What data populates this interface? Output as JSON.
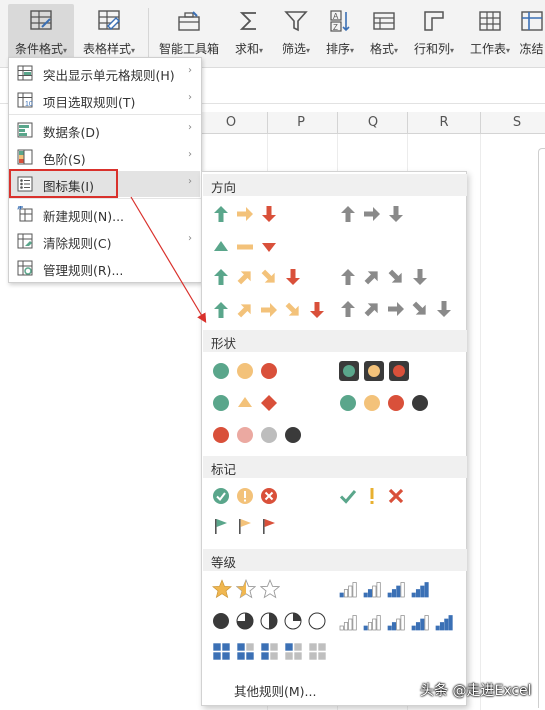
{
  "ribbon": {
    "buttons": [
      {
        "label": "条件格式",
        "caret": "▾",
        "icon": "conditional-format-icon"
      },
      {
        "label": "表格样式",
        "caret": "▾",
        "icon": "table-style-icon"
      },
      {
        "label": "智能工具箱",
        "caret": "",
        "icon": "toolbox-icon"
      },
      {
        "label": "求和",
        "caret": "▾",
        "icon": "sum-icon"
      },
      {
        "label": "筛选",
        "caret": "▾",
        "icon": "filter-icon"
      },
      {
        "label": "排序",
        "caret": "▾",
        "icon": "sort-icon"
      },
      {
        "label": "格式",
        "caret": "▾",
        "icon": "format-icon"
      },
      {
        "label": "行和列",
        "caret": "▾",
        "icon": "rows-columns-icon"
      },
      {
        "label": "工作表",
        "caret": "▾",
        "icon": "worksheet-icon"
      },
      {
        "label": "冻结",
        "caret": "",
        "icon": "freeze-icon"
      }
    ]
  },
  "sheet": {
    "columns": [
      "O",
      "P",
      "Q",
      "R",
      "S"
    ]
  },
  "menu": {
    "items": [
      {
        "label": "突出显示单元格规则(H)",
        "submenu": true,
        "icon": "highlight-rules-icon"
      },
      {
        "label": "项目选取规则(T)",
        "submenu": true,
        "icon": "top-bottom-rules-icon"
      },
      {
        "label": "数据条(D)",
        "submenu": true,
        "icon": "data-bars-icon"
      },
      {
        "label": "色阶(S)",
        "submenu": true,
        "icon": "color-scales-icon"
      },
      {
        "label": "图标集(I)",
        "submenu": true,
        "icon": "icon-sets-icon",
        "active": true
      },
      {
        "label": "新建规则(N)...",
        "submenu": false,
        "icon": "new-rule-icon"
      },
      {
        "label": "清除规则(C)",
        "submenu": true,
        "icon": "clear-rules-icon"
      },
      {
        "label": "管理规则(R)...",
        "submenu": false,
        "icon": "manage-rules-icon"
      }
    ]
  },
  "submenu": {
    "sections": [
      {
        "title": "方向"
      },
      {
        "title": "形状"
      },
      {
        "title": "标记"
      },
      {
        "title": "等级"
      }
    ],
    "more_label": "其他规则(M)...",
    "icon_sets": [
      {
        "name": "3-arrows-colored",
        "icons": [
          "arrow-up-green-icon",
          "arrow-right-yellow-icon",
          "arrow-down-red-icon"
        ]
      },
      {
        "name": "3-arrows-gray",
        "icons": [
          "arrow-up-gray-icon",
          "arrow-right-gray-icon",
          "arrow-down-gray-icon"
        ]
      },
      {
        "name": "3-triangles",
        "icons": [
          "triangle-up-green-icon",
          "dash-yellow-icon",
          "triangle-down-red-icon"
        ]
      },
      {
        "name": "4-arrows-gray",
        "icons": [
          "arrow-up-gray-icon",
          "arrow-upright-gray-icon",
          "arrow-downright-gray-icon",
          "arrow-down-gray-icon"
        ]
      },
      {
        "name": "4-arrows-colored",
        "icons": [
          "arrow-up-green-icon",
          "arrow-upright-yellow-icon",
          "arrow-downright-yellow-icon",
          "arrow-down-red-icon"
        ]
      },
      {
        "name": "5-arrows-gray",
        "icons": [
          "arrow-up-gray-icon",
          "arrow-upright-gray-icon",
          "arrow-right-gray-icon",
          "arrow-downright-gray-icon",
          "arrow-down-gray-icon"
        ]
      },
      {
        "name": "5-arrows-colored",
        "icons": [
          "arrow-up-green-icon",
          "arrow-upright-yellow-icon",
          "arrow-right-yellow-icon",
          "arrow-downright-yellow-icon",
          "arrow-down-red-icon"
        ]
      },
      {
        "name": "3-traffic-lights-unrimmed",
        "icons": [
          "circle-green-icon",
          "circle-yellow-icon",
          "circle-red-icon"
        ]
      },
      {
        "name": "3-traffic-lights-rimmed",
        "icons": [
          "traffic-light-green-icon",
          "traffic-light-yellow-icon",
          "traffic-light-red-icon"
        ]
      },
      {
        "name": "3-signs",
        "icons": [
          "circle-green-icon",
          "triangle-yellow-icon",
          "diamond-red-icon"
        ]
      },
      {
        "name": "4-traffic-lights",
        "icons": [
          "circle-green-icon",
          "circle-yellow-icon",
          "circle-red-icon",
          "circle-black-icon"
        ]
      },
      {
        "name": "4-red-to-black",
        "icons": [
          "circle-red-icon",
          "circle-pink-icon",
          "circle-gray-icon",
          "circle-black-icon"
        ]
      },
      {
        "name": "3-symbols-circled",
        "icons": [
          "check-circle-green-icon",
          "exclamation-circle-yellow-icon",
          "x-circle-red-icon"
        ]
      },
      {
        "name": "3-symbols-uncircled",
        "icons": [
          "check-green-icon",
          "exclamation-yellow-icon",
          "x-red-icon"
        ]
      },
      {
        "name": "3-flags",
        "icons": [
          "flag-green-icon",
          "flag-yellow-icon",
          "flag-red-icon"
        ]
      },
      {
        "name": "3-stars",
        "icons": [
          "star-full-icon",
          "star-half-icon",
          "star-empty-icon"
        ]
      },
      {
        "name": "4-ratings",
        "icons": [
          "signal-1-icon",
          "signal-2-icon",
          "signal-3-icon",
          "signal-4-icon"
        ]
      },
      {
        "name": "5-quarters",
        "icons": [
          "quarter-4-icon",
          "quarter-3-icon",
          "quarter-2-icon",
          "quarter-1-icon",
          "quarter-0-icon"
        ]
      },
      {
        "name": "5-ratings",
        "icons": [
          "signal-0-icon",
          "signal-1-icon",
          "signal-2-icon",
          "signal-3-icon",
          "signal-4-icon"
        ]
      },
      {
        "name": "5-boxes",
        "icons": [
          "boxes-4-icon",
          "boxes-3-icon",
          "boxes-2-icon",
          "boxes-1-icon",
          "boxes-0-icon"
        ]
      }
    ]
  },
  "colors": {
    "green": "#5aa68b",
    "yellow": "#f3c27a",
    "red": "#d9503a",
    "gray": "#8a8a8a",
    "black": "#3a3a3a",
    "pink": "#eba9a1",
    "light_gray": "#bdbdbd",
    "blue": "#3b70b5",
    "highlight_border": "#d9312c",
    "arrow": "#d9312c"
  },
  "watermark": "头条 @走进Excel"
}
